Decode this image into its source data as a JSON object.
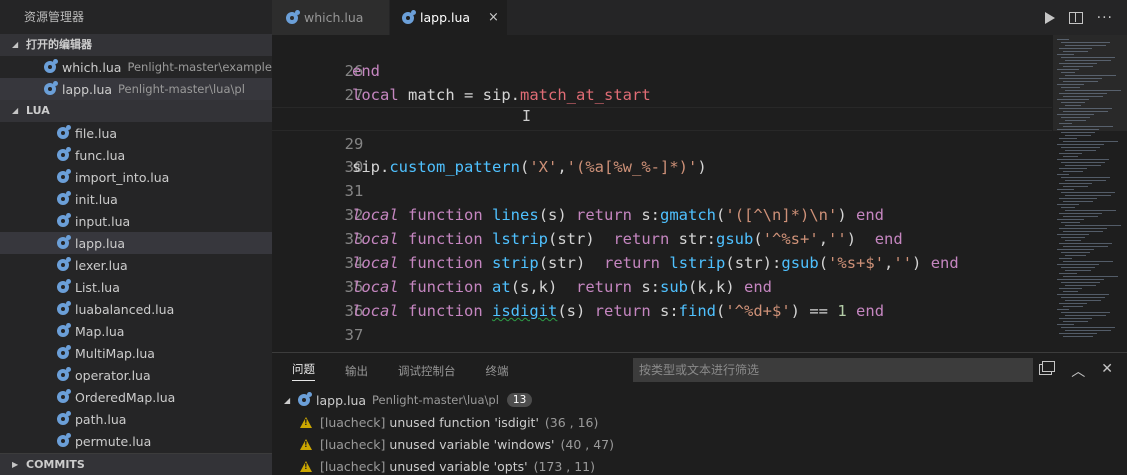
{
  "sidebar": {
    "title": "资源管理器",
    "open_editors": {
      "header": "打开的编辑器",
      "items": [
        {
          "name": "which.lua",
          "path": "Penlight-master\\examples"
        },
        {
          "name": "lapp.lua",
          "path": "Penlight-master\\lua\\pl"
        }
      ]
    },
    "lua": {
      "header": "LUA",
      "files": [
        "file.lua",
        "func.lua",
        "import_into.lua",
        "init.lua",
        "input.lua",
        "lapp.lua",
        "lexer.lua",
        "List.lua",
        "luabalanced.lua",
        "Map.lua",
        "MultiMap.lua",
        "operator.lua",
        "OrderedMap.lua",
        "path.lua",
        "permute.lua"
      ]
    },
    "commits_header": "COMMITS"
  },
  "tabs": [
    {
      "label": "which.lua",
      "active": false
    },
    {
      "label": "lapp.lua",
      "active": true,
      "close": "×"
    }
  ],
  "editor": {
    "line_numbers": [
      "26",
      "27",
      "28",
      "29",
      "30",
      "31",
      "32",
      "33",
      "34",
      "35",
      "36",
      "37",
      "38"
    ]
  },
  "panel": {
    "tabs": [
      "问题",
      "输出",
      "调试控制台",
      "终端"
    ],
    "filter_placeholder": "按类型或文本进行筛选",
    "file": {
      "name": "lapp.lua",
      "path": "Penlight-master\\lua\\pl",
      "count": "13"
    },
    "problems": [
      {
        "source": "[luacheck]",
        "message": "unused function 'isdigit'",
        "pos": "(36 , 16)"
      },
      {
        "source": "[luacheck]",
        "message": "unused variable 'windows'",
        "pos": "(40 , 47)"
      },
      {
        "source": "[luacheck]",
        "message": "unused variable 'opts'",
        "pos": "(173 , 11)"
      }
    ]
  },
  "colors": {
    "keyword": "#c586c0",
    "function": "#4fc1ff",
    "string": "#ce9178",
    "number": "#b5cea8",
    "warning": "#cca700"
  }
}
